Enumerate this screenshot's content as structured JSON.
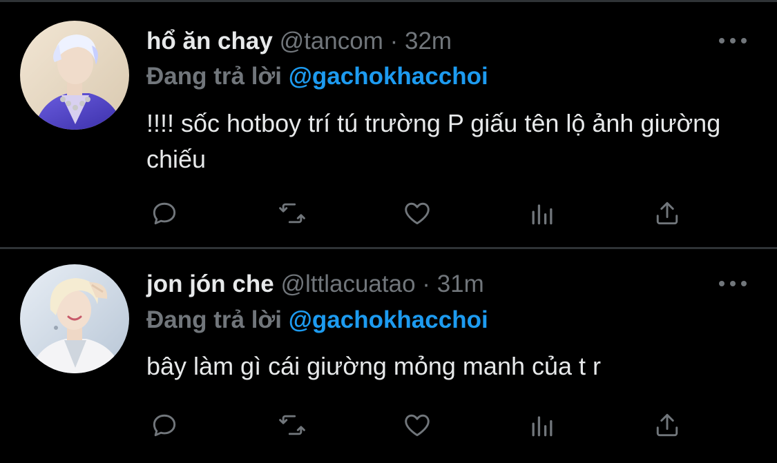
{
  "tweets": [
    {
      "display_name": "hổ ăn chay",
      "handle": "@tancom",
      "separator": "·",
      "time": "32m",
      "reply_prefix": "Đang trả lời",
      "reply_mention": "@gachokhacchoi",
      "text": "!!!! sốc hotboy trí tú trường P giấu tên lộ ảnh giường chiếu",
      "avatar_icon": "avatar-photo"
    },
    {
      "display_name": "jon jón che",
      "handle": "@lttlacuatao",
      "separator": "·",
      "time": "31m",
      "reply_prefix": "Đang trả lời",
      "reply_mention": "@gachokhacchoi",
      "text": "bây làm gì cái giường mỏng manh của t r",
      "avatar_icon": "avatar-photo"
    }
  ],
  "actions": [
    "reply-icon",
    "retweet-icon",
    "like-icon",
    "analytics-icon",
    "share-icon"
  ],
  "colors": {
    "background": "#000000",
    "divider": "#2f3336",
    "primary_text": "#e7e9ea",
    "secondary_text": "#71767b",
    "accent": "#1d9bf0"
  }
}
